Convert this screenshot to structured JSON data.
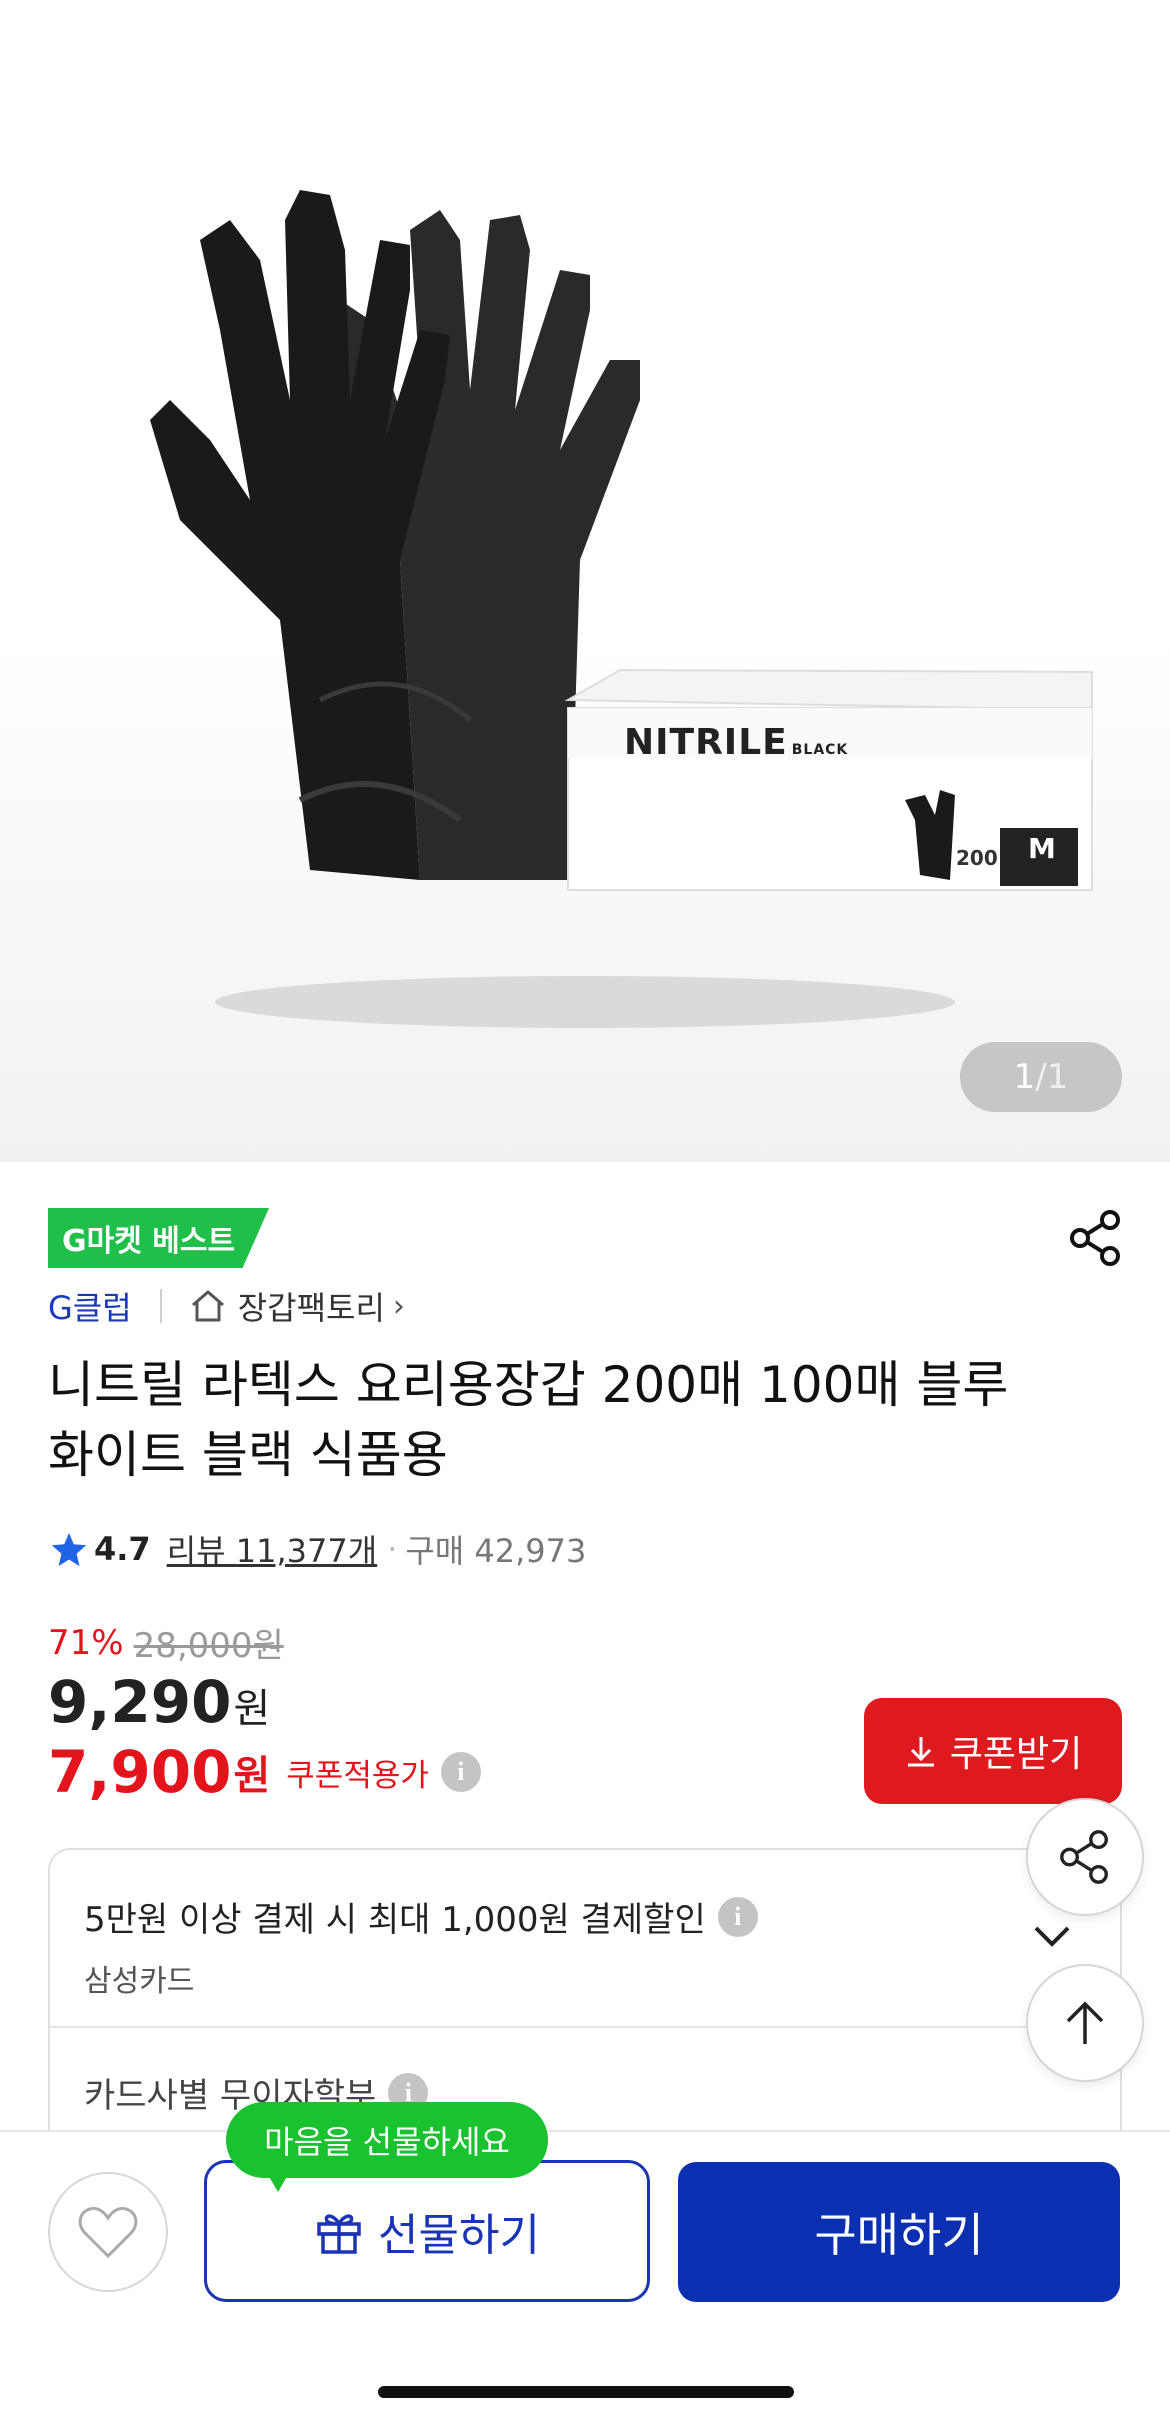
{
  "product_image": {
    "box_brand": "NITRILE",
    "box_sub": "BLACK",
    "box_count": "200",
    "box_size": "M",
    "page_current": "1",
    "page_sep": "/",
    "page_total": "1"
  },
  "badge": {
    "label": "G마켓 베스트",
    "color": "#1fbf4a"
  },
  "brand": {
    "club": "G클럽",
    "store": "장갑팩토리",
    "store_chevron": "›"
  },
  "title": "니트릴 라텍스 요리용장갑 200매 100매 블루 화이트 블랙 식품용",
  "rating": {
    "score": "4.7",
    "reviews": "리뷰 11,377개",
    "separator": "·",
    "purchases": "구매 42,973"
  },
  "price": {
    "discount": "71%",
    "original": "28,000원",
    "current": "9,290",
    "current_unit": "원",
    "coupon_price": "7,900",
    "coupon_unit": "원",
    "coupon_label": "쿠폰적용가",
    "coupon_button": "쿠폰받기",
    "accent": "#e3141b"
  },
  "benefits": {
    "item1": "5만원 이상 결제 시 최대 1,000원 결제할인",
    "item1_sub": "삼성카드",
    "item2": "카드사별 무이자할부"
  },
  "bottom": {
    "tooltip": "마음을 선물하세요",
    "gift": "선물하기",
    "buy": "구매하기",
    "buy_color": "#0a2fb0"
  }
}
